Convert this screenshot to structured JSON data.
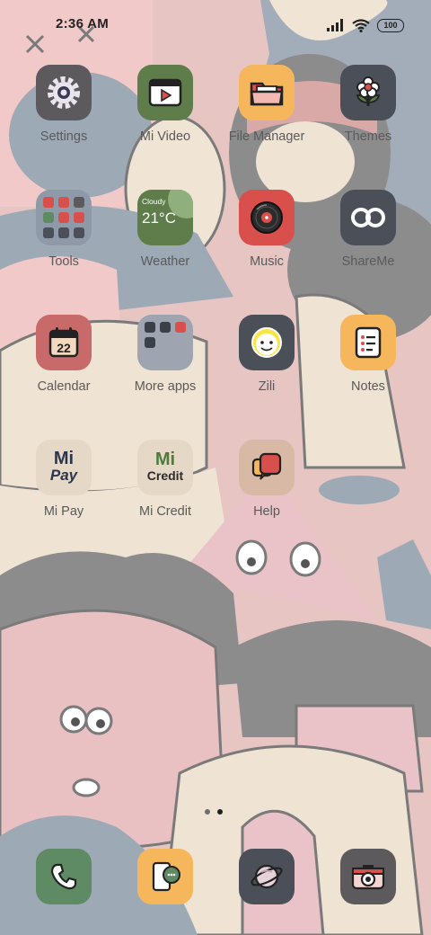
{
  "status": {
    "time": "2:36 AM",
    "battery": "100"
  },
  "rows": [
    [
      {
        "id": "settings",
        "label": "Settings",
        "icon": "gear-icon",
        "bg": "#5d5a5d"
      },
      {
        "id": "mi-video",
        "label": "Mi Video",
        "icon": "video-player-icon",
        "bg": "#5e7d4a"
      },
      {
        "id": "file-manager",
        "label": "File Manager",
        "icon": "folder-icon",
        "bg": "#f6b65c"
      },
      {
        "id": "themes",
        "label": "Themes",
        "icon": "flower-icon",
        "bg": "#4a4f58"
      }
    ],
    [
      {
        "id": "tools",
        "label": "Tools",
        "icon": "folder-grid-icon",
        "bg": "#8f9aa8"
      },
      {
        "id": "weather",
        "label": "Weather",
        "icon": "weather-widget-icon",
        "bg": "#5e7d4a"
      },
      {
        "id": "music",
        "label": "Music",
        "icon": "vinyl-record-icon",
        "bg": "#d94f4c"
      },
      {
        "id": "shareme",
        "label": "ShareMe",
        "icon": "infinity-icon",
        "bg": "#4a4f58"
      }
    ],
    [
      {
        "id": "calendar",
        "label": "Calendar",
        "icon": "calendar-icon",
        "bg": "#c96a6a"
      },
      {
        "id": "more-apps",
        "label": "More apps",
        "icon": "folder-grid-icon",
        "bg": "#9fa5b0"
      },
      {
        "id": "zili",
        "label": "Zili",
        "icon": "smiley-face-icon",
        "bg": "#4a4f58"
      },
      {
        "id": "notes",
        "label": "Notes",
        "icon": "notepad-icon",
        "bg": "#f6b65c"
      }
    ],
    [
      {
        "id": "mi-pay",
        "label": "Mi Pay",
        "icon": "mi-pay-logo-icon",
        "bg": "#e5d8c7"
      },
      {
        "id": "mi-credit",
        "label": "Mi Credit",
        "icon": "mi-credit-logo-icon",
        "bg": "#e5d8c7"
      },
      {
        "id": "help",
        "label": "Help",
        "icon": "chat-bubble-icon",
        "bg": "#d8b9a5"
      }
    ]
  ],
  "tile_text": {
    "weather_condition": "Cloudy",
    "weather_temp": "21°C",
    "calendar_day": "22",
    "mi": "Mi",
    "pay": "Pay",
    "credit": "Credit"
  },
  "dock": [
    {
      "id": "phone",
      "icon": "phone-icon",
      "bg": "#5e8a64"
    },
    {
      "id": "messaging",
      "icon": "messaging-icon",
      "bg": "#f6b65c"
    },
    {
      "id": "browser",
      "icon": "planet-icon",
      "bg": "#4a4f58"
    },
    {
      "id": "camera",
      "icon": "camera-icon",
      "bg": "#5d5a5d"
    }
  ],
  "page_indicator": {
    "pages": 2,
    "active": 2
  }
}
